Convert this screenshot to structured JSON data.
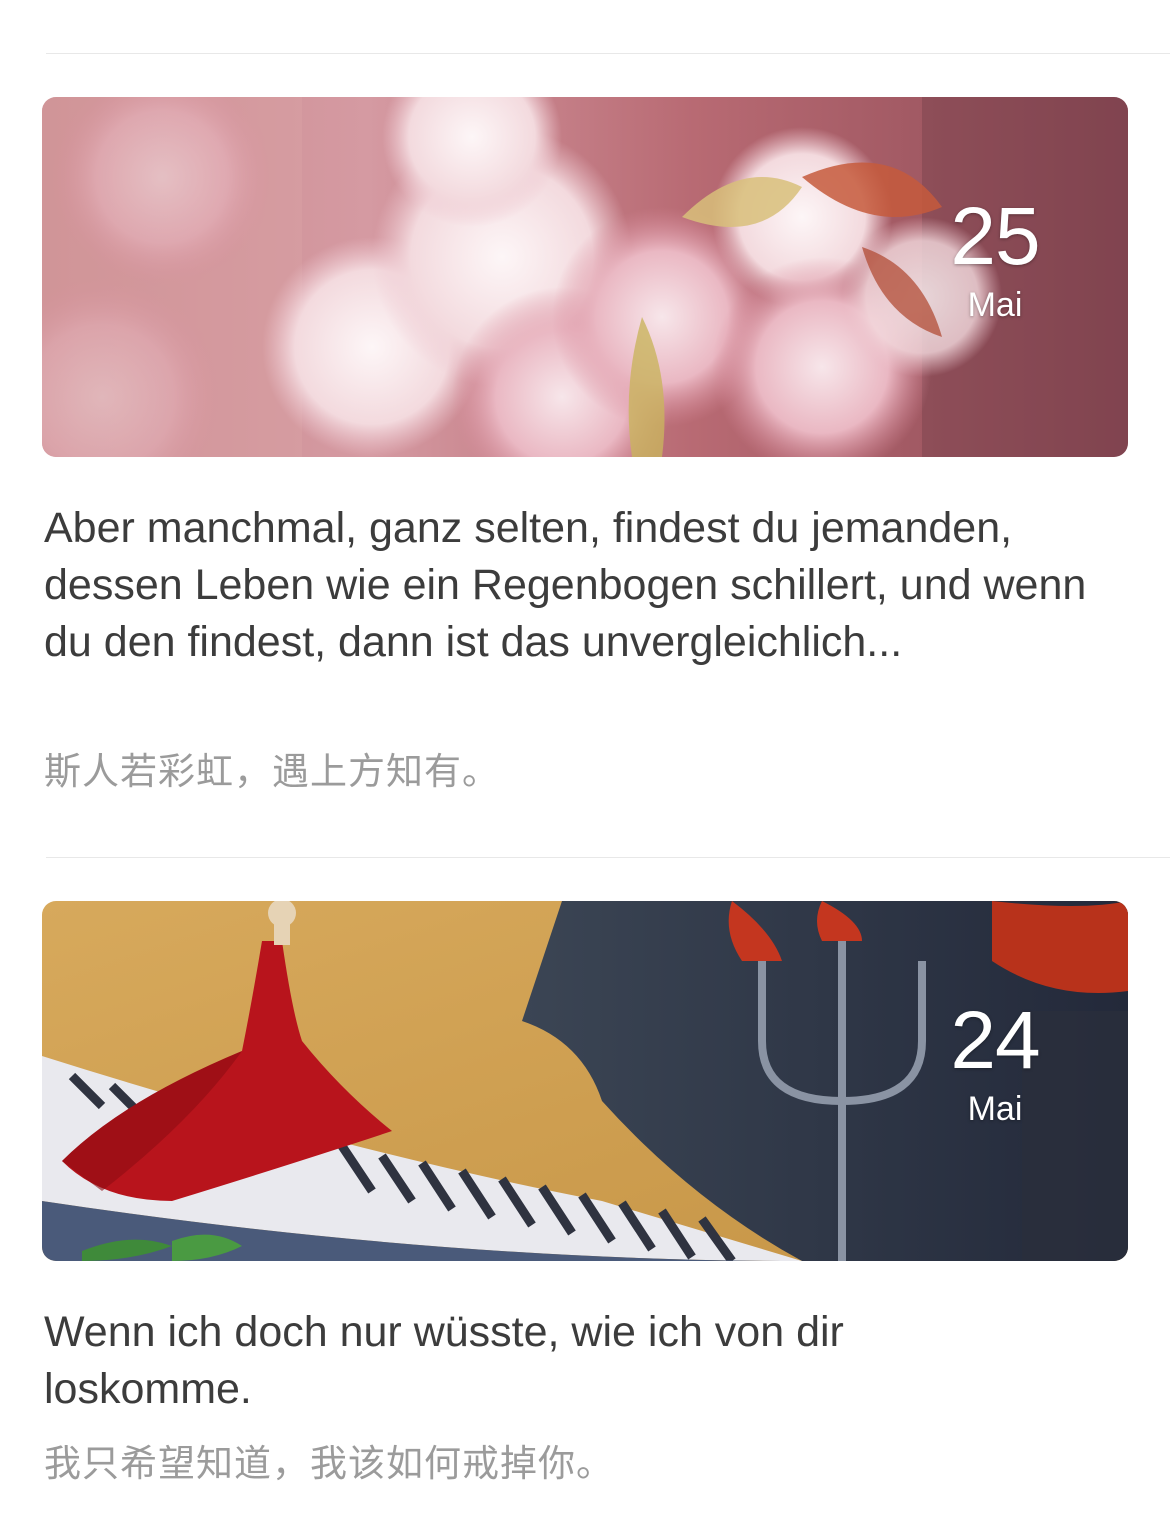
{
  "posts": [
    {
      "day": "25",
      "month": "Mai",
      "quote_de": "Aber manchmal, ganz selten, findest du jemanden, dessen Leben wie ein Regenbogen schillert, und wenn du den findest, dann ist das unvergleichlich...",
      "quote_zh": "斯人若彩虹，遇上方知有。",
      "image": "cherry-blossom-photo"
    },
    {
      "day": "24",
      "month": "Mai",
      "quote_de": "Wenn ich doch nur wüsste, wie ich von dir loskomme.",
      "quote_zh": "我只希望知道，我该如何戒掉你。",
      "image": "piano-painting"
    }
  ],
  "colors": {
    "text_primary": "#3c3c3c",
    "text_secondary": "#9b9b9b",
    "divider": "#e8e8e8",
    "date_text": "#ffffff"
  }
}
